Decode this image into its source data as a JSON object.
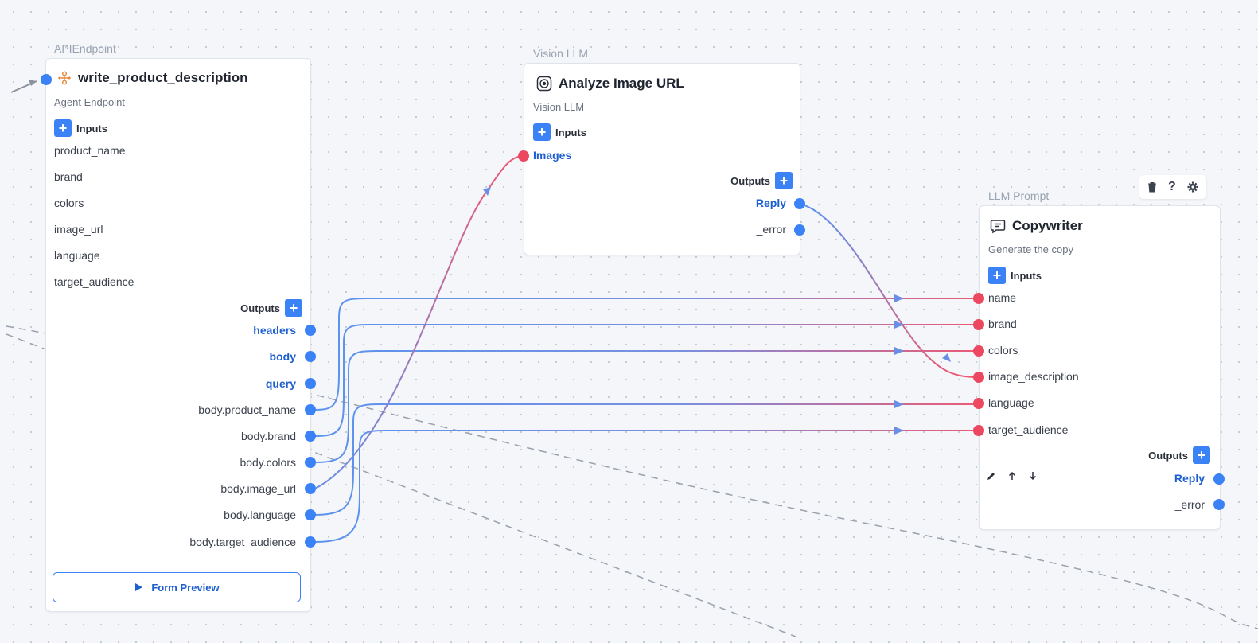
{
  "api_node": {
    "title": "APIEndpoint",
    "name": "write_product_description",
    "subtitle": "Agent Endpoint",
    "inputs_label": "Inputs",
    "params": [
      "product_name",
      "brand",
      "colors",
      "image_url",
      "language",
      "target_audience"
    ],
    "outputs_label": "Outputs",
    "outputs": [
      "headers",
      "body",
      "query",
      "body.product_name",
      "body.brand",
      "body.colors",
      "body.image_url",
      "body.language",
      "body.target_audience"
    ],
    "preview_label": "Form Preview"
  },
  "vision_node": {
    "title": "Vision LLM",
    "name": "Analyze Image URL",
    "subtitle": "Vision LLM",
    "inputs_label": "Inputs",
    "inputs": [
      "Images"
    ],
    "outputs_label": "Outputs",
    "outputs": [
      "Reply",
      "_error"
    ]
  },
  "llm_node": {
    "title": "LLM Prompt",
    "name": "Copywriter",
    "subtitle": "Generate the copy",
    "inputs_label": "Inputs",
    "inputs": [
      "name",
      "brand",
      "colors",
      "image_description",
      "language",
      "target_audience"
    ],
    "outputs_label": "Outputs",
    "outputs": [
      "Reply",
      "_error"
    ],
    "toolbar_icons": [
      "trash-icon",
      "help-icon",
      "gear-icon"
    ],
    "edit_icons": [
      "pencil-icon",
      "arrow-up-icon",
      "arrow-down-icon"
    ]
  },
  "colors": {
    "accent": "#3b82f6",
    "input_port": "#ec4860",
    "output_port": "#3b82f6"
  }
}
